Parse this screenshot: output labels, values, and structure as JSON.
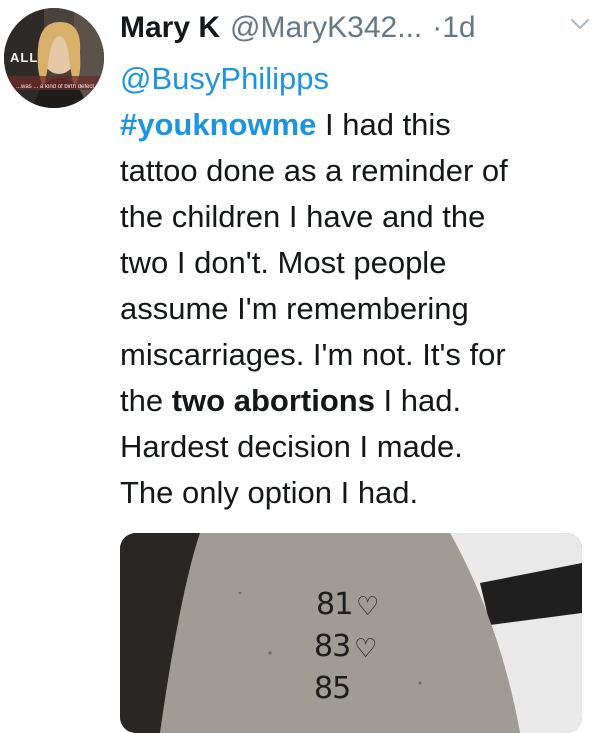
{
  "tweet": {
    "author_name": "Mary K",
    "author_handle": "@MaryK342...",
    "timestamp": "·1d",
    "menu_icon": "chevron-down-icon",
    "avatar_caption": "...was ... a kind of birth defect.",
    "avatar_letters": "ALL",
    "reply_to": "@BusyPhilipps",
    "hashtag": "#youknowme",
    "text_line1_rest": " I had this",
    "text_line2": "tattoo done as a reminder of",
    "text_line3": "the children I have and the",
    "text_line4": "two I don't. Most people",
    "text_line5": "assume I'm remembering",
    "text_line6": "miscarriages. I'm not. It's for",
    "text_line7_pre": "the ",
    "text_line7_bold": "two abortions",
    "text_line7_post": " I had.",
    "text_line8": "Hardest decision I made.",
    "text_line9": "The only option I had."
  },
  "media": {
    "tattoo_lines": [
      "81",
      "83",
      "85"
    ]
  },
  "colors": {
    "link": "#1b95e0",
    "secondary": "#657786",
    "text": "#14171a"
  }
}
